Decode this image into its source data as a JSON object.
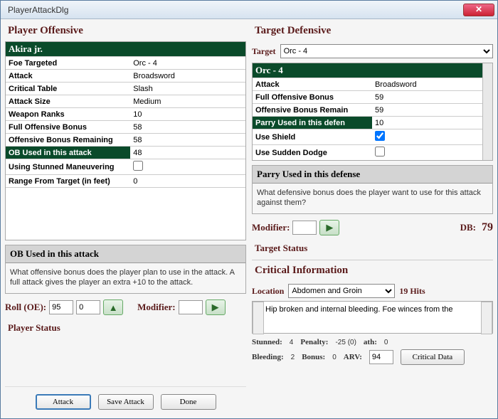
{
  "window": {
    "title": "PlayerAttackDlg"
  },
  "offensive": {
    "title": "Player Offensive",
    "player": "Akira jr.",
    "rows": [
      {
        "label": "Foe Targeted",
        "value": "Orc - 4"
      },
      {
        "label": "Attack",
        "value": "Broadsword"
      },
      {
        "label": "Critical Table",
        "value": "Slash"
      },
      {
        "label": "Attack Size",
        "value": "Medium"
      },
      {
        "label": "Weapon Ranks",
        "value": "10"
      },
      {
        "label": "Full Offensive Bonus",
        "value": "58"
      },
      {
        "label": "Offensive Bonus Remaining",
        "value": "58"
      },
      {
        "label": "OB Used in this attack",
        "value": "48",
        "selected": true
      },
      {
        "label": "Using Stunned Maneuvering",
        "value": "",
        "check": true,
        "checked": false
      },
      {
        "label": "Range From Target  (in feet)",
        "value": "0"
      }
    ],
    "help": {
      "title": "OB Used in this attack",
      "body": "What offensive bonus does the player plan to use in the attack. A full attack gives the player an extra +10 to the attack."
    },
    "roll_label": "Roll (OE):",
    "roll1": "95",
    "roll2": "0",
    "modifier_label": "Modifier:",
    "modifier": "",
    "status_label": "Player Status"
  },
  "defensive": {
    "title": "Target Defensive",
    "target_label": "Target",
    "target_value": "Orc - 4",
    "rows": [
      {
        "label": "Attack",
        "value": "Broadsword"
      },
      {
        "label": "Full Offensive Bonus",
        "value": "59"
      },
      {
        "label": "Offensive Bonus Remain",
        "value": "59"
      },
      {
        "label": "Parry Used in this defen",
        "value": "10",
        "selected": true
      },
      {
        "label": "Use Shield",
        "value": "",
        "check": true,
        "checked": true
      },
      {
        "label": "Use Sudden Dodge",
        "value": "",
        "check": true,
        "checked": false
      }
    ],
    "help": {
      "title": "Parry Used in this defense",
      "body": "What defensive bonus does the player want to use for this attack against them?"
    },
    "modifier_label": "Modifier:",
    "modifier": "",
    "db_label": "DB:",
    "db_value": "79",
    "status_label": "Target Status"
  },
  "critical": {
    "title": "Critical Information",
    "location_label": "Location",
    "location_value": "Abdomen and Groin",
    "hits": "19 Hits",
    "text": "Hip broken and internal bleeding. Foe winces from the",
    "stats": {
      "stunned_l": "Stunned:",
      "stunned": "4",
      "penalty_l": "Penalty:",
      "penalty": "-25 (0)",
      "death_l": "ath:",
      "death": "0",
      "bleeding_l": "Bleeding:",
      "bleeding": "2",
      "bonus_l": "Bonus:",
      "bonus": "0",
      "arv_l": "ARV:",
      "arv": "94"
    },
    "crit_btn": "Critical Data"
  },
  "buttons": {
    "attack": "Attack",
    "save": "Save Attack",
    "done": "Done"
  }
}
